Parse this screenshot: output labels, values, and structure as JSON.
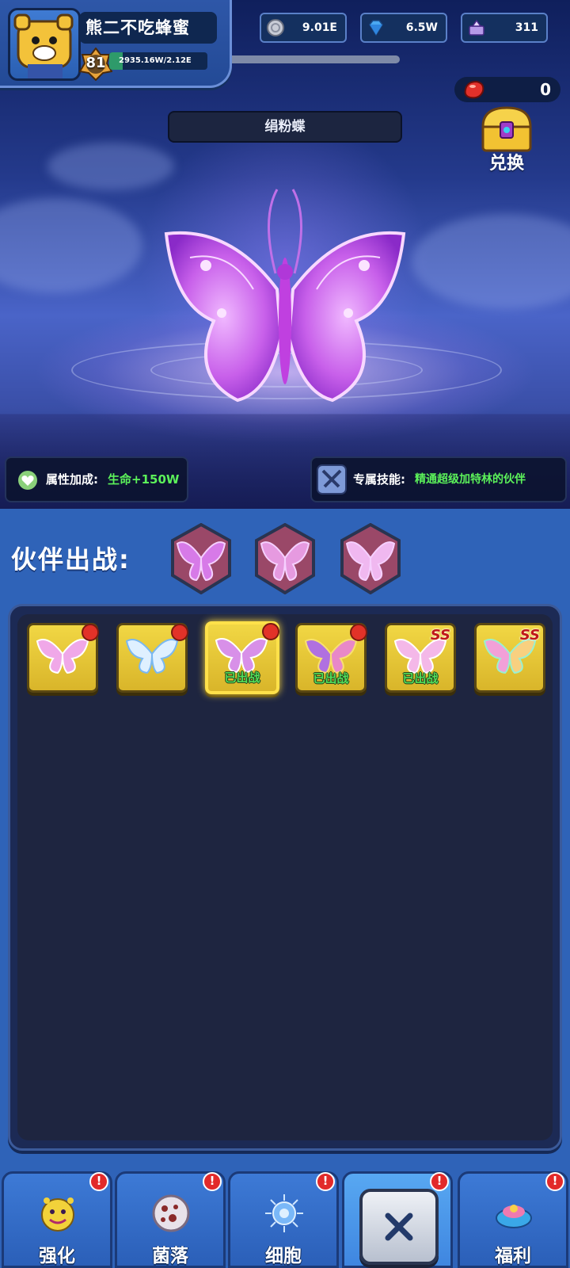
{
  "player": {
    "name": "熊二不吃蜂蜜",
    "level": "81",
    "exp_text": "2935.16W/2.12E",
    "exp_progress": 0.14
  },
  "currencies": [
    {
      "icon": "silver-coin-icon",
      "value": "9.01E"
    },
    {
      "icon": "blue-diamond-icon",
      "value": "6.5W"
    },
    {
      "icon": "purple-gem-chest-icon",
      "value": "311"
    }
  ],
  "ruby": {
    "icon": "red-ruby-icon",
    "count": "0"
  },
  "exchange": {
    "label": "兑换"
  },
  "partner": {
    "title": "绢粉蝶",
    "bonus_label": "属性加成:",
    "bonus_value": "生命+150W",
    "skill_label": "专属技能:",
    "skill_value": "精通超级加特林的伙伴"
  },
  "deploy": {
    "label": "伙伴出战:",
    "slots": [
      "pink-butterfly",
      "pink-butterfly",
      "pink-butterfly"
    ]
  },
  "cards": [
    {
      "name": "pink-butterfly",
      "red_dot": true,
      "deployed": "",
      "grade": ""
    },
    {
      "name": "blue-white-butterfly",
      "red_dot": true,
      "deployed": "",
      "grade": ""
    },
    {
      "name": "purple-butterfly",
      "red_dot": true,
      "deployed": "已出战",
      "grade": "",
      "selected": true
    },
    {
      "name": "rainbow-butterfly",
      "red_dot": true,
      "deployed": "已出战",
      "grade": ""
    },
    {
      "name": "pink-butterfly",
      "red_dot": false,
      "deployed": "已出战",
      "grade": "SS"
    },
    {
      "name": "rainbow-butterfly",
      "red_dot": false,
      "deployed": "",
      "grade": "SS"
    }
  ],
  "nav": [
    {
      "label": "强化",
      "alert": "!"
    },
    {
      "label": "菌落",
      "alert": "!"
    },
    {
      "label": "细胞",
      "alert": "!"
    },
    {
      "label": "",
      "alert": "!"
    },
    {
      "label": "福利",
      "alert": "!"
    }
  ],
  "colors": {
    "panel_blue": "#2f63b8",
    "card_gold": "#f1d744",
    "text_green": "#5cf25a",
    "alert_red": "#e22a2a"
  }
}
